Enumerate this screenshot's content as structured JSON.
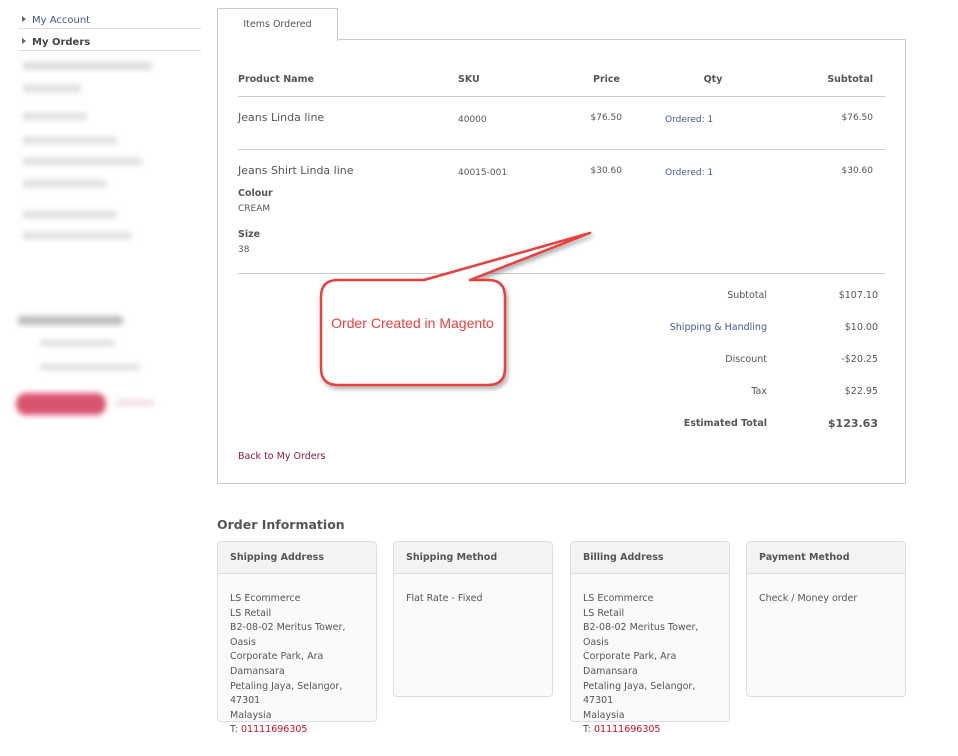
{
  "sidebar": {
    "items": [
      {
        "label": "My Account"
      },
      {
        "label": "My Orders"
      }
    ]
  },
  "tab": {
    "label": "Items Ordered"
  },
  "table": {
    "headers": [
      "Product Name",
      "SKU",
      "Price",
      "Qty",
      "Subtotal"
    ],
    "rows": [
      {
        "name": "Jeans Linda line",
        "sku": "40000",
        "price": "$76.50",
        "qty": "Ordered: 1",
        "subtotal": "$76.50"
      },
      {
        "name": "Jeans Shirt Linda line",
        "sku": "40015-001",
        "price": "$30.60",
        "qty": "Ordered: 1",
        "subtotal": "$30.60",
        "options": [
          {
            "label": "Colour",
            "value": "CREAM"
          },
          {
            "label": "Size",
            "value": "38"
          }
        ]
      }
    ]
  },
  "totals": [
    {
      "label": "Subtotal",
      "value": "$107.10"
    },
    {
      "label": "Shipping & Handling",
      "value": "$10.00"
    },
    {
      "label": "Discount",
      "value": "-$20.25"
    },
    {
      "label": "Tax",
      "value": "$22.95"
    },
    {
      "label": "Estimated Total",
      "value": "$123.63"
    }
  ],
  "back_link": "Back to My Orders",
  "callout": "Order Created in Magento",
  "order_info": {
    "title": "Order Information",
    "shipping_address": {
      "title": "Shipping Address",
      "lines": [
        "LS Ecommerce",
        "LS Retail",
        "B2-08-02 Meritus Tower, Oasis",
        "Corporate Park, Ara",
        "Damansara",
        "Petaling Jaya, Selangor, 47301",
        "Malaysia"
      ],
      "phone_prefix": "T: ",
      "phone": "01111696305"
    },
    "shipping_method": {
      "title": "Shipping Method",
      "value": "Flat Rate - Fixed"
    },
    "billing_address": {
      "title": "Billing Address",
      "lines": [
        "LS Ecommerce",
        "LS Retail",
        "B2-08-02 Meritus Tower, Oasis",
        "Corporate Park, Ara",
        "Damansara",
        "Petaling Jaya, Selangor, 47301",
        "Malaysia"
      ],
      "phone_prefix": "T: ",
      "phone": "01111696305"
    },
    "payment_method": {
      "title": "Payment Method",
      "value": "Check / Money order"
    }
  },
  "colors": {
    "accent": "#8b1a3a",
    "callout": "#e8413c",
    "phone": "#c8102e"
  }
}
